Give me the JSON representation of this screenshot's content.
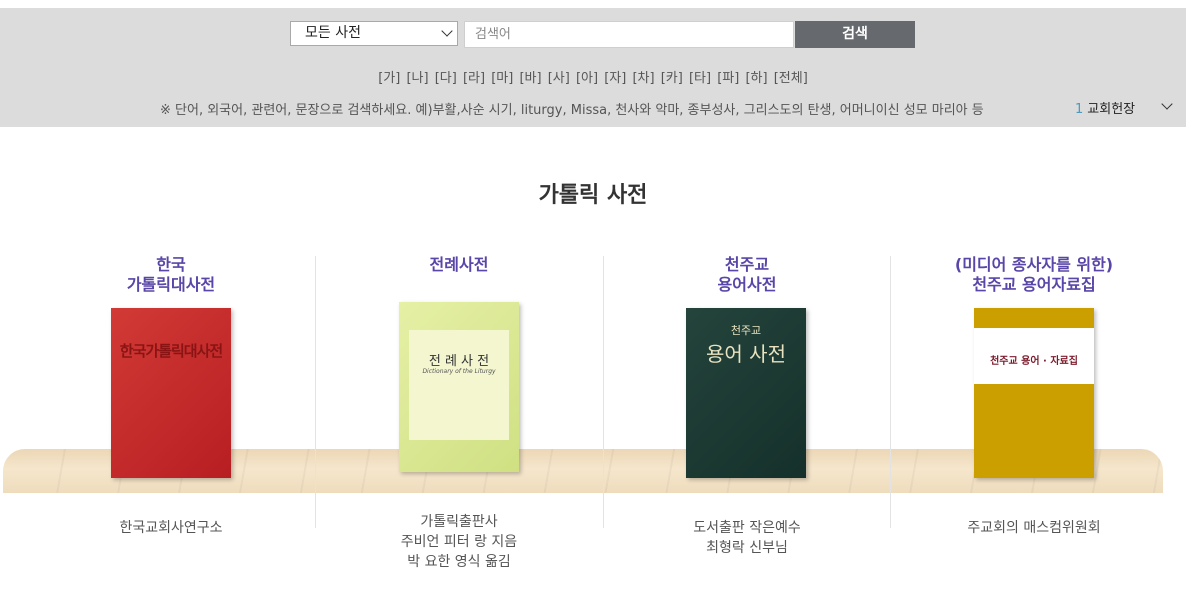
{
  "search": {
    "scope_value": "모든 사전",
    "placeholder": "검색어",
    "button_label": "검색"
  },
  "index": [
    "[가]",
    "[나]",
    "[다]",
    "[라]",
    "[마]",
    "[바]",
    "[사]",
    "[아]",
    "[자]",
    "[차]",
    "[카]",
    "[타]",
    "[파]",
    "[하]",
    "[전체]"
  ],
  "hint_text": "※ 단어, 외국어, 관련어, 문장으로 검색하세요. 예)부활,사순 시기, liturgy, Missa, 천사와 악마, 종부성사, 그리스도의 탄생, 어머니이신 성모 마리아 등",
  "ticker": {
    "number": "1",
    "label": "교회헌장"
  },
  "page_title": "가톨릭 사전",
  "books": [
    {
      "title_line1": "한국",
      "title_line2": "가톨릭대사전",
      "cover_text": "한국가톨릭대사전",
      "desc_lines": [
        "한국교회사연구소"
      ],
      "cover_color": "#c92b2b"
    },
    {
      "title_line1": "전례사전",
      "title_line2": "",
      "cover_text": "전 례 사 전",
      "cover_sub": "Dictionary of the Liturgy",
      "desc_lines": [
        "가톨릭출판사",
        "주비언 피터 랑 지음",
        "박 요한 영식 옮김"
      ],
      "cover_color": "#d9e89a"
    },
    {
      "title_line1": "천주교",
      "title_line2": "용어사전",
      "cover_text": "용어 사전",
      "cover_top": "천주교",
      "desc_lines": [
        "도서출판 작은예수",
        "최형락 신부님"
      ],
      "cover_color": "#1f3a33"
    },
    {
      "title_line1": "(미디어 종사자를 위한)",
      "title_line2": "천주교 용어자료집",
      "cover_text": "천주교 용어 · 자료집",
      "desc_lines": [
        "주교회의 매스컴위원회"
      ],
      "cover_color": "#cc9f00"
    }
  ]
}
